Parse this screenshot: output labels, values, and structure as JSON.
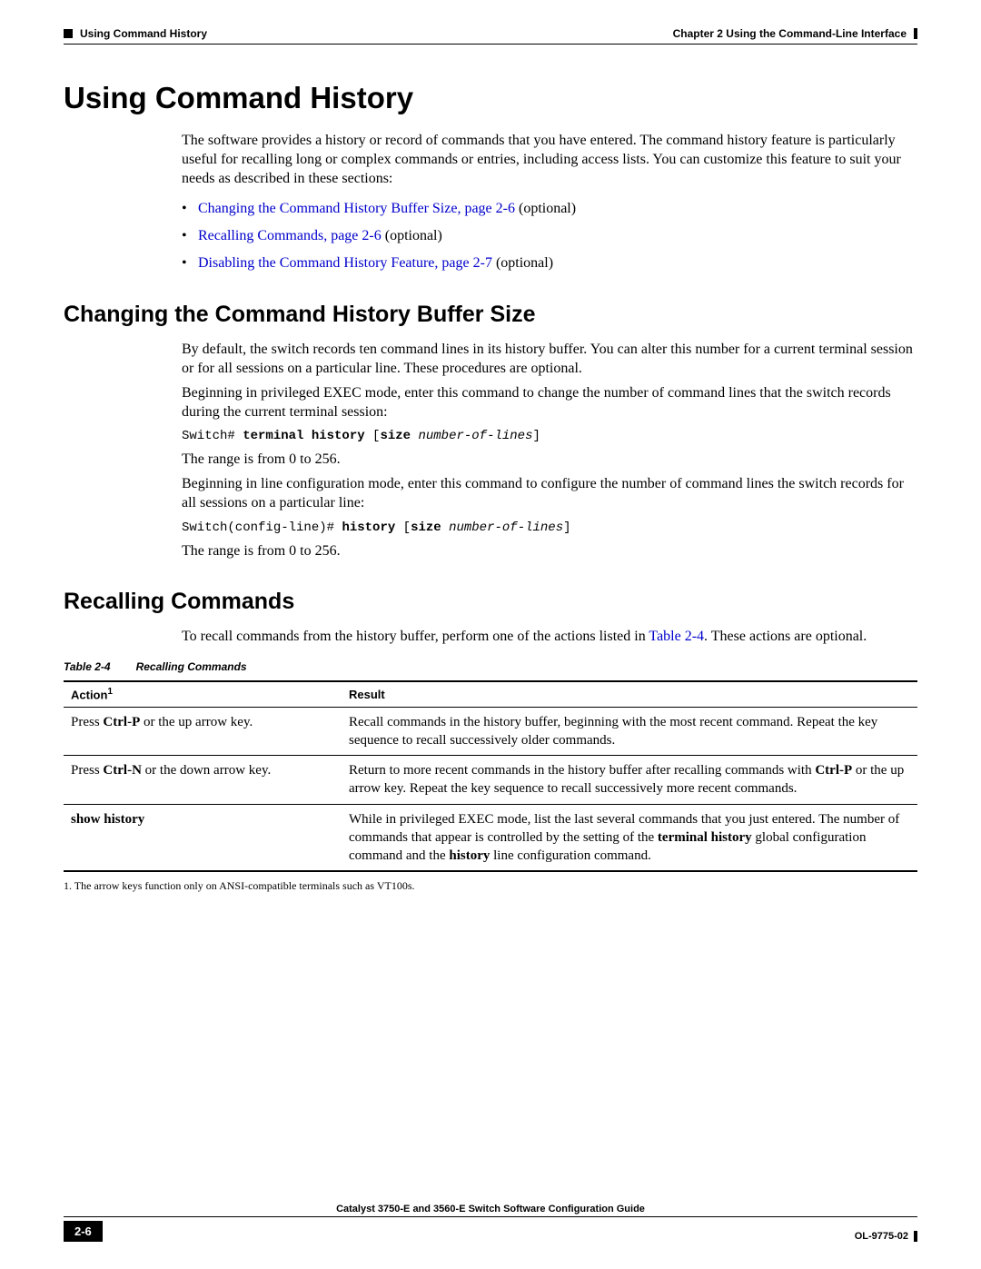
{
  "header": {
    "section_left": "Using Command History",
    "chapter_right": "Chapter 2      Using the Command-Line Interface"
  },
  "h1": "Using Command History",
  "intro": "The software provides a history or record of commands that you have entered. The command history feature is particularly useful for recalling long or complex commands or entries, including access lists. You can customize this feature to suit your needs as described in these sections:",
  "bullets": [
    {
      "link": "Changing the Command History Buffer Size, page 2-6",
      "tail": " (optional)"
    },
    {
      "link": "Recalling Commands, page 2-6",
      "tail": " (optional)"
    },
    {
      "link": "Disabling the Command History Feature, page 2-7",
      "tail": " (optional)"
    }
  ],
  "s1": {
    "title": "Changing the Command History Buffer Size",
    "p1": "By default, the switch records ten command lines in its history buffer. You can alter this number for a current terminal session or for all sessions on a particular line. These procedures are optional.",
    "p2": "Beginning in privileged EXEC mode, enter this command to change the number of command lines that the switch records during the current terminal session:",
    "cmd1_plain": "Switch# ",
    "cmd1_bold": "terminal history",
    "cmd1_open": " [",
    "cmd1_size": "size",
    "cmd1_space": " ",
    "cmd1_ital": "number-of-lines",
    "cmd1_close": "]",
    "p3": "The range is from 0 to 256.",
    "p4": "Beginning in line configuration mode, enter this command to configure the number of command lines the switch records for all sessions on a particular line:",
    "cmd2_plain": "Switch(config-line)# ",
    "cmd2_bold": "history",
    "cmd2_open": " [",
    "cmd2_size": "size",
    "cmd2_space": " ",
    "cmd2_ital": "number-of-lines",
    "cmd2_close": "]",
    "p5": "The range is from 0 to 256."
  },
  "s2": {
    "title": "Recalling Commands",
    "p_a": "To recall commands from the history buffer, perform one of the actions listed in ",
    "p_link": "Table 2-4",
    "p_b": ". These actions are optional."
  },
  "table": {
    "caption_num": "Table 2-4",
    "caption_title": "Recalling Commands",
    "head_action": "Action",
    "head_sup": "1",
    "head_result": "Result",
    "r1_a1": "Press ",
    "r1_a2": "Ctrl-P",
    "r1_a3": " or the up arrow key.",
    "r1_res": "Recall commands in the history buffer, beginning with the most recent command. Repeat the key sequence to recall successively older commands.",
    "r2_a1": "Press ",
    "r2_a2": "Ctrl-N",
    "r2_a3": " or the down arrow key.",
    "r2_res_a": "Return to more recent commands in the history buffer after recalling commands with ",
    "r2_res_b": "Ctrl-P",
    "r2_res_c": " or the up arrow key. Repeat the key sequence to recall successively more recent commands.",
    "r3_action": "show history",
    "r3_res_a": "While in privileged EXEC mode, list the last several commands that you just entered. The number of commands that appear is controlled by the setting of the ",
    "r3_res_b": "terminal history",
    "r3_res_c": " global configuration command and the ",
    "r3_res_d": "history",
    "r3_res_e": " line configuration command.",
    "footnote": "1.  The arrow keys function only on ANSI-compatible terminals such as VT100s."
  },
  "footer": {
    "book": "Catalyst 3750-E and 3560-E Switch Software Configuration Guide",
    "pagenum": "2-6",
    "docid": "OL-9775-02"
  }
}
